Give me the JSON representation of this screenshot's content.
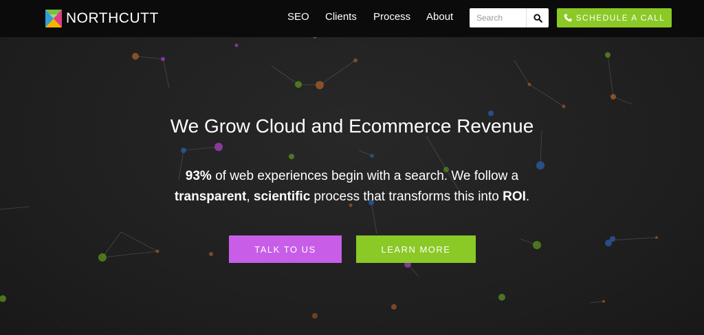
{
  "brand": {
    "name": "NORTHCUTT"
  },
  "nav": {
    "items": [
      {
        "label": "SEO"
      },
      {
        "label": "Clients"
      },
      {
        "label": "Process"
      },
      {
        "label": "About"
      }
    ],
    "search_placeholder": "Search",
    "cta_label": "SCHEDULE A CALL"
  },
  "hero": {
    "title": "We Grow Cloud and Ecommerce Revenue",
    "line1": {
      "stat": "93%",
      "rest": " of web experiences begin with a search. We follow a"
    },
    "line2": {
      "w1": "transparent",
      "sep": ", ",
      "w2": "scientific",
      "mid": " process that transforms this into ",
      "w3": "ROI",
      "end": "."
    },
    "buttons": {
      "talk": "TALK TO US",
      "learn": "LEARN MORE"
    }
  },
  "colors": {
    "accent_green": "#8ac926",
    "accent_purple": "#c85ee8",
    "header_bg": "#0b0b0b",
    "page_bg": "#1e1e1e"
  },
  "icons": [
    "logo-mark",
    "search-icon",
    "phone-icon"
  ]
}
